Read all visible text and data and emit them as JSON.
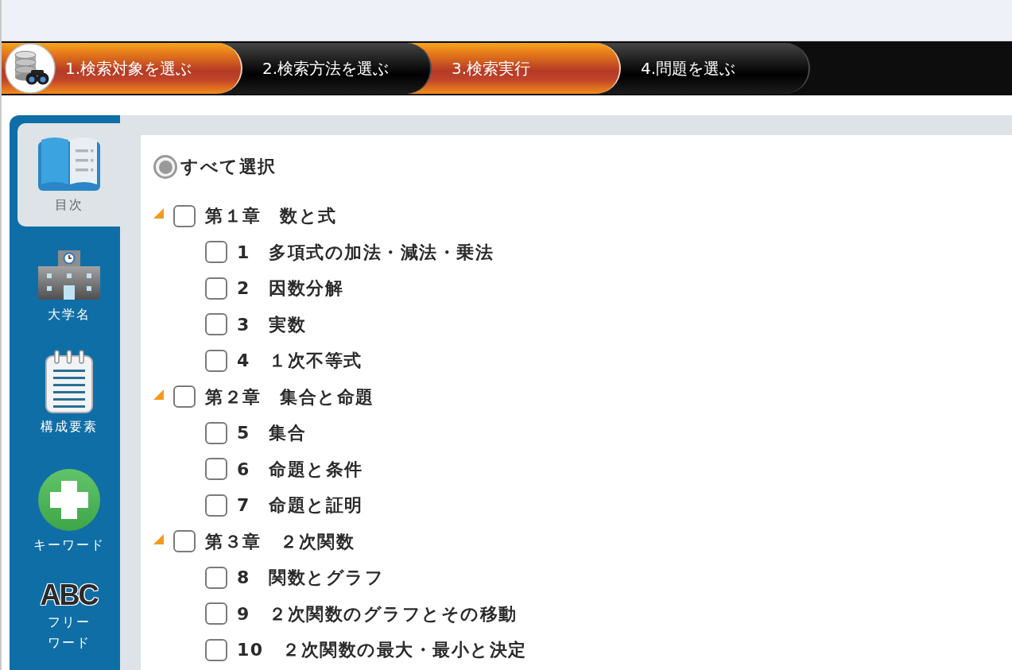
{
  "steps": [
    {
      "label": "1.検索対象を選ぶ",
      "highlighted": true
    },
    {
      "label": "2.検索方法を選ぶ",
      "highlighted": false
    },
    {
      "label": "3.検索実行",
      "highlighted": true
    },
    {
      "label": "4.問題を選ぶ",
      "highlighted": false
    }
  ],
  "sidebar": {
    "items": [
      {
        "kind": "book",
        "label": "目次",
        "selected": true
      },
      {
        "kind": "school",
        "label": "大学名",
        "selected": false
      },
      {
        "kind": "notepad",
        "label": "構成要素",
        "selected": false
      },
      {
        "kind": "plus",
        "label": "キーワード",
        "selected": false
      },
      {
        "kind": "lettering",
        "icon_text": "ABC",
        "label": "フリーワード",
        "selected": false
      }
    ]
  },
  "select_all": {
    "label": "すべて選択",
    "selected": true
  },
  "tree": [
    {
      "label": "第１章　数と式",
      "expanded": true,
      "checked": false,
      "children": [
        {
          "label": "1　多項式の加法・減法・乗法",
          "checked": false
        },
        {
          "label": "2　因数分解",
          "checked": false
        },
        {
          "label": "3　実数",
          "checked": false
        },
        {
          "label": "4　１次不等式",
          "checked": false
        }
      ]
    },
    {
      "label": "第２章　集合と命題",
      "expanded": true,
      "checked": false,
      "children": [
        {
          "label": "5　集合",
          "checked": false
        },
        {
          "label": "6　命題と条件",
          "checked": false
        },
        {
          "label": "7　命題と証明",
          "checked": false
        }
      ]
    },
    {
      "label": "第３章　２次関数",
      "expanded": true,
      "checked": false,
      "children": [
        {
          "label": "8　関数とグラフ",
          "checked": false
        },
        {
          "label": "9　２次関数のグラフとその移動",
          "checked": false
        },
        {
          "label": "10　２次関数の最大・最小と決定",
          "checked": false
        }
      ]
    }
  ]
}
